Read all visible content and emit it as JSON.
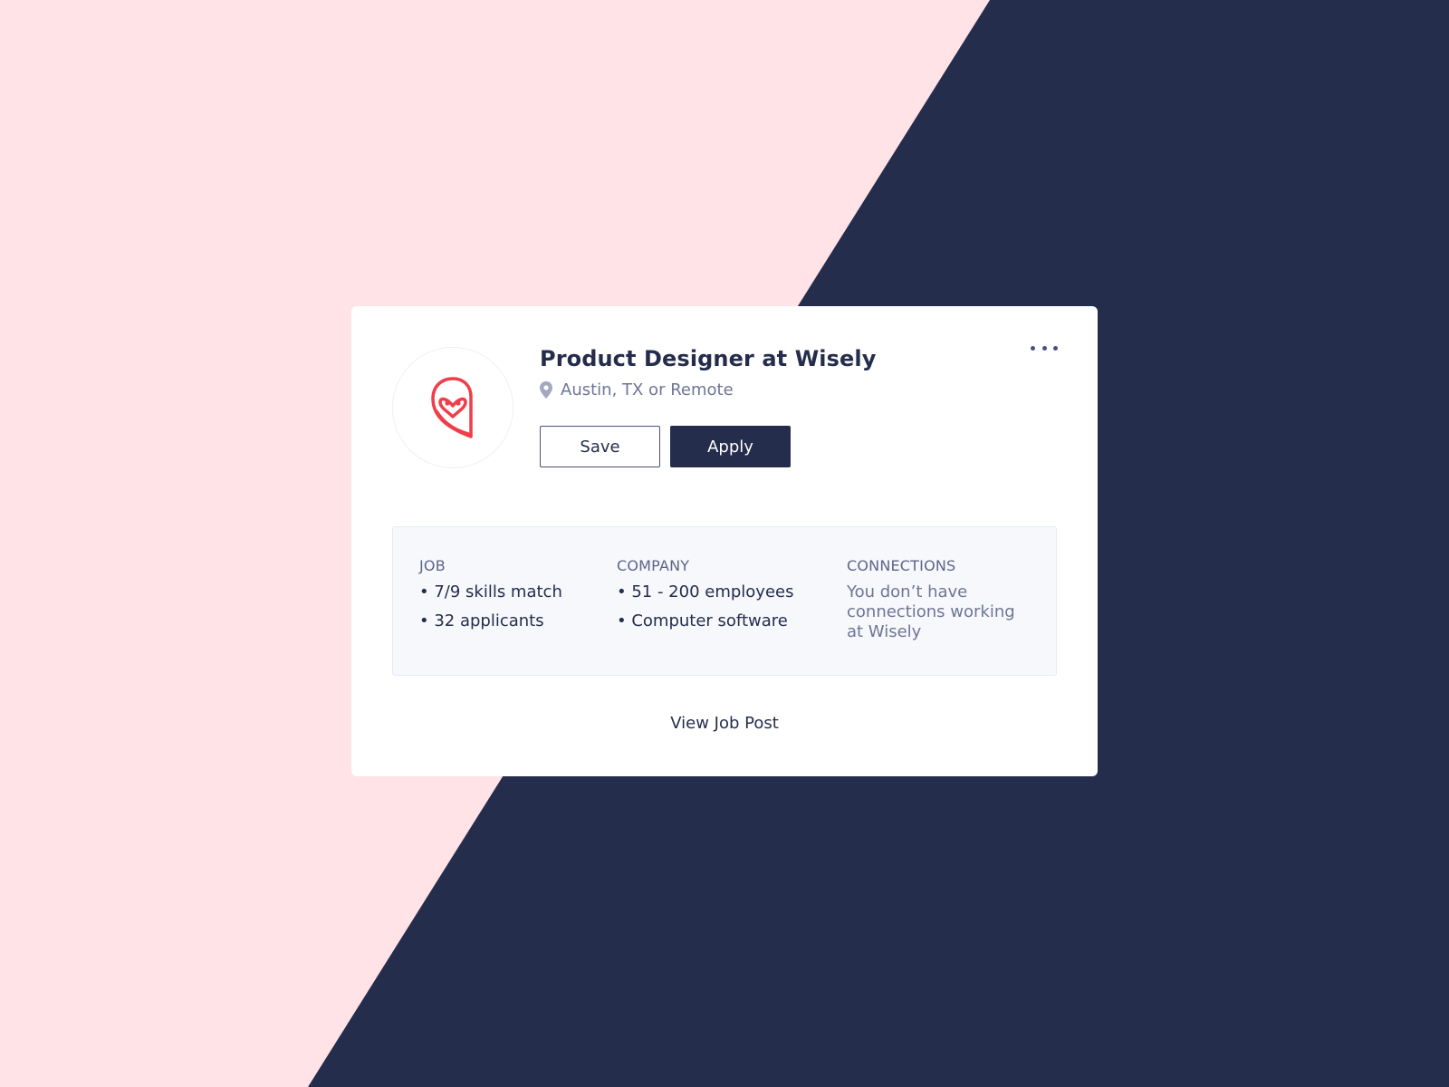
{
  "colors": {
    "background_pink": "#ffe3e7",
    "background_navy": "#252d4c",
    "logo_red": "#ef3e49",
    "muted_text": "#6e7596"
  },
  "card": {
    "title": "Product Designer at Wisely",
    "location": "Austin, TX or Remote",
    "save_label": "Save",
    "apply_label": "Apply",
    "more_icon": "more-horizontal-icon",
    "logo_icon": "owl-logo-icon",
    "location_icon": "map-pin-icon"
  },
  "info": {
    "job": {
      "heading": "JOB",
      "items": [
        "• 7/9 skills match",
        "• 32 applicants"
      ]
    },
    "company": {
      "heading": "COMPANY",
      "items": [
        "• 51 - 200 employees",
        "• Computer software"
      ]
    },
    "connections": {
      "heading": "CONNECTIONS",
      "text": "You don’t have connections working at Wisely"
    }
  },
  "footer": {
    "view_job_label": "View Job Post"
  }
}
